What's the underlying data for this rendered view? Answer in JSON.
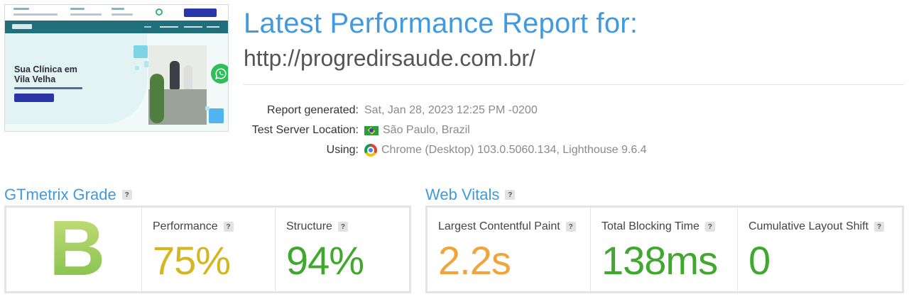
{
  "thumbnail": {
    "hero_title_line1": "Sua Clínica em",
    "hero_title_line2": "Vila Velha"
  },
  "header": {
    "title": "Latest Performance Report for:",
    "url": "http://progredirsaude.com.br/"
  },
  "meta": {
    "report_generated_label": "Report generated:",
    "report_generated_value": "Sat, Jan 28, 2023 12:25 PM -0200",
    "location_label": "Test Server Location:",
    "location_value": "São Paulo, Brazil",
    "using_label": "Using:",
    "using_value": "Chrome (Desktop) 103.0.5060.134, Lighthouse 9.6.4"
  },
  "gtmetrix": {
    "title": "GTmetrix Grade",
    "help": "?",
    "grade": "B",
    "performance_label": "Performance",
    "performance_value": "75%",
    "structure_label": "Structure",
    "structure_value": "94%"
  },
  "web_vitals": {
    "title": "Web Vitals",
    "help": "?",
    "lcp_label": "Largest Contentful Paint",
    "lcp_value": "2.2s",
    "tbt_label": "Total Blocking Time",
    "tbt_value": "138ms",
    "cls_label": "Cumulative Layout Shift",
    "cls_value": "0"
  },
  "colors": {
    "accent": "#3f9ae0",
    "grade_green": "#8cc152",
    "performance_yellow": "#d5b620",
    "good_green": "#3fa82d",
    "warning_orange": "#f2a33a"
  },
  "icons": {
    "flag": "brazil-flag-icon",
    "browser": "chrome-icon",
    "help": "help-icon",
    "whatsapp": "whatsapp-icon"
  }
}
